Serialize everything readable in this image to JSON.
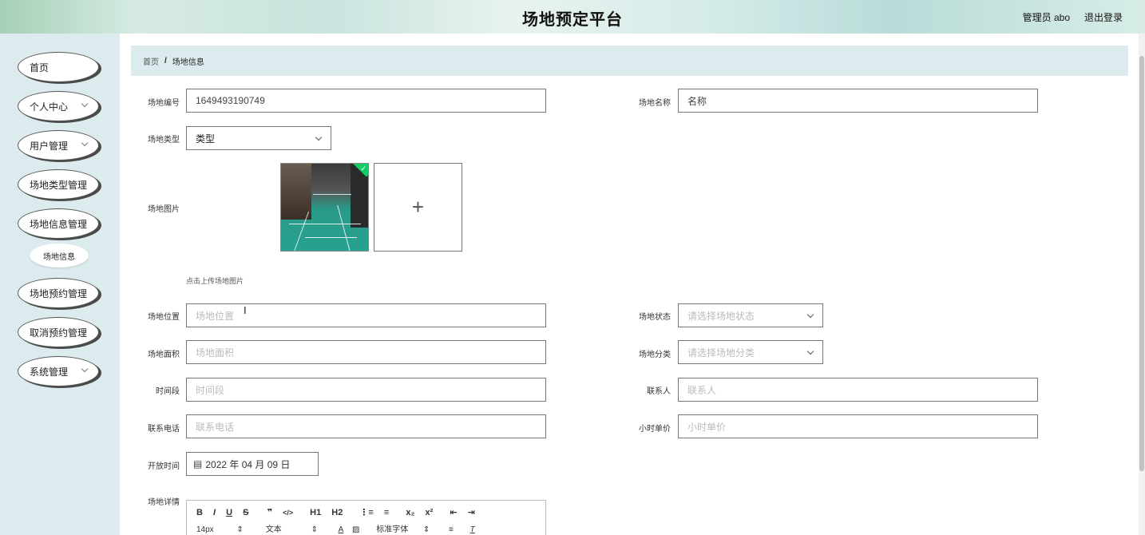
{
  "header": {
    "title": "场地预定平台",
    "user_label": "管理员 abo",
    "logout_label": "退出登录"
  },
  "sidebar": {
    "items": [
      {
        "label": "首页",
        "has_children": false
      },
      {
        "label": "个人中心",
        "has_children": true
      },
      {
        "label": "用户管理",
        "has_children": true
      },
      {
        "label": "场地类型管理",
        "has_children": false
      },
      {
        "label": "场地信息管理",
        "has_children": false
      },
      {
        "label": "场地预约管理",
        "has_children": false
      },
      {
        "label": "取消预约管理",
        "has_children": false
      },
      {
        "label": "系统管理",
        "has_children": true
      }
    ],
    "submenu": {
      "label": "场地信息"
    }
  },
  "breadcrumb": {
    "home": "首页",
    "separator": "/",
    "current": "场地信息"
  },
  "form": {
    "venue_no": {
      "label": "场地编号",
      "value": "1649493190749"
    },
    "venue_name": {
      "label": "场地名称",
      "value": "名称"
    },
    "venue_type": {
      "label": "场地类型",
      "value": "类型"
    },
    "venue_image": {
      "label": "场地图片",
      "upload_tip": "点击上传场地图片",
      "plus": "+"
    },
    "location": {
      "label": "场地位置",
      "placeholder": "场地位置"
    },
    "status": {
      "label": "场地状态",
      "placeholder": "请选择场地状态"
    },
    "area": {
      "label": "场地面积",
      "placeholder": "场地面积"
    },
    "category": {
      "label": "场地分类",
      "placeholder": "请选择场地分类"
    },
    "time_slot": {
      "label": "时间段",
      "placeholder": "时间段"
    },
    "contact": {
      "label": "联系人",
      "placeholder": "联系人"
    },
    "phone": {
      "label": "联系电话",
      "placeholder": "联系电话"
    },
    "hourly_price": {
      "label": "小时单价",
      "placeholder": "小时单价"
    },
    "open_time": {
      "label": "开放时间",
      "value": "2022 年 04 月 09 日"
    },
    "details": {
      "label": "场地详情",
      "toolbar_row1": [
        "B",
        "I",
        "U",
        "S",
        "❞",
        "</>",
        "H1",
        "H2",
        "⋮≡",
        "≡",
        "x₂",
        "x²",
        "⇤",
        "⇥"
      ],
      "font_size": "14px",
      "text_style": "文本",
      "font_family": "标准字体"
    }
  },
  "colors": {
    "sidebar_bg": "#dcecee",
    "breadcrumb_bg": "#dcecee",
    "accent_check": "#13ce66"
  }
}
